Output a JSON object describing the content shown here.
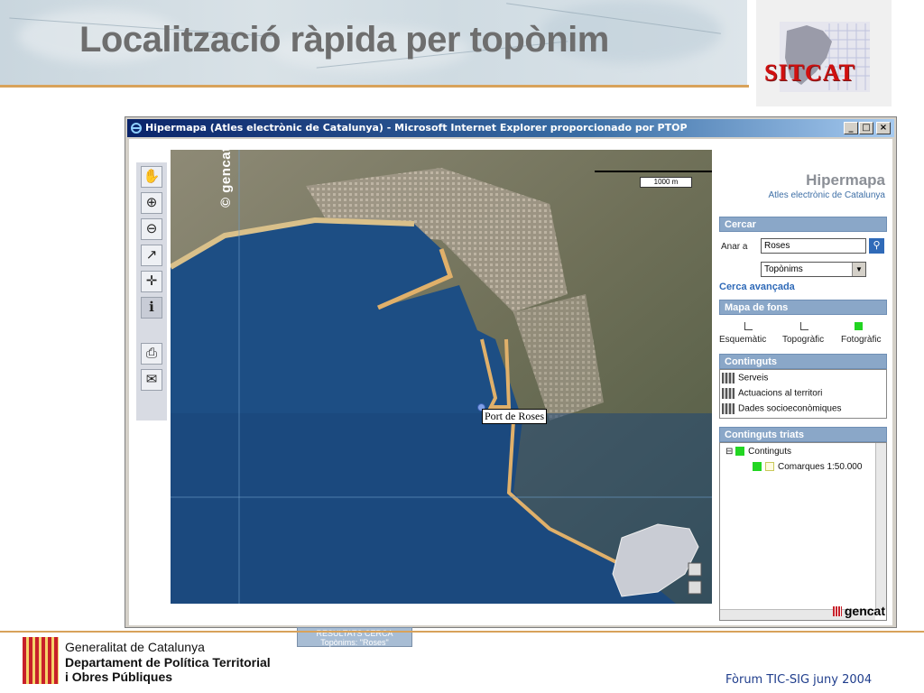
{
  "slide": {
    "title": "Localització ràpida per topònim",
    "logo_text": "SITCAT",
    "footer_org_line1": "Generalitat de Catalunya",
    "footer_org_line2": "Departament de Política Territorial",
    "footer_org_line3": "i Obres Públiques",
    "footer_event": "Fòrum TIC-SIG juny 2004"
  },
  "window": {
    "title": "Hipermapa (Atles electrònic de Catalunya) - Microsoft Internet Explorer proporcionado por PTOP",
    "btn_minimize": "_",
    "btn_maximize": "□",
    "btn_close": "×"
  },
  "toolbar": {
    "tools": [
      {
        "name": "pan-tool",
        "icon": "hand-icon",
        "glyph": "✋"
      },
      {
        "name": "zoom-in-tool",
        "icon": "zoom-in-icon",
        "glyph": "⊕"
      },
      {
        "name": "zoom-out-tool",
        "icon": "zoom-out-icon",
        "glyph": "⊖"
      },
      {
        "name": "measure-tool",
        "icon": "measure-icon",
        "glyph": "↗"
      },
      {
        "name": "center-tool",
        "icon": "move-icon",
        "glyph": "✛"
      },
      {
        "name": "info-tool",
        "icon": "info-icon",
        "glyph": "ℹ"
      },
      {
        "name": "print-tool",
        "icon": "printer-icon",
        "glyph": "⎙"
      },
      {
        "name": "mail-tool",
        "icon": "mail-icon",
        "glyph": "✉"
      }
    ]
  },
  "map": {
    "watermark": "© gencat",
    "scale_label": "1000 m",
    "place_label": "Port de Roses",
    "results_line1": "RESULTATS CERCA",
    "results_line2": "Topònims: \"Roses\""
  },
  "panel": {
    "title": "Hipermapa",
    "subtitle": "Atles electrònic de Catalunya",
    "search_header": "Cercar",
    "go_to_label": "Anar a",
    "search_value": "Roses",
    "search_type": "Topònims",
    "advanced_search": "Cerca avançada",
    "basemap_header": "Mapa de fons",
    "basemaps": [
      {
        "label": "Esquemàtic",
        "selected": false
      },
      {
        "label": "Topogràfic",
        "selected": false
      },
      {
        "label": "Fotogràfic",
        "selected": true
      }
    ],
    "contents_header": "Continguts",
    "contents": [
      "Serveis",
      "Actuacions al territori",
      "Dades socioeconòmiques"
    ],
    "chosen_header": "Continguts triats",
    "tree": [
      "Continguts",
      "Comarques 1:50.000"
    ],
    "footer_logo": "gencat"
  },
  "colors": {
    "accent": "#d8a25a",
    "panel_header": "#8aa7c8",
    "link": "#2f6ab8",
    "sitcat_red": "#d10f0f"
  }
}
